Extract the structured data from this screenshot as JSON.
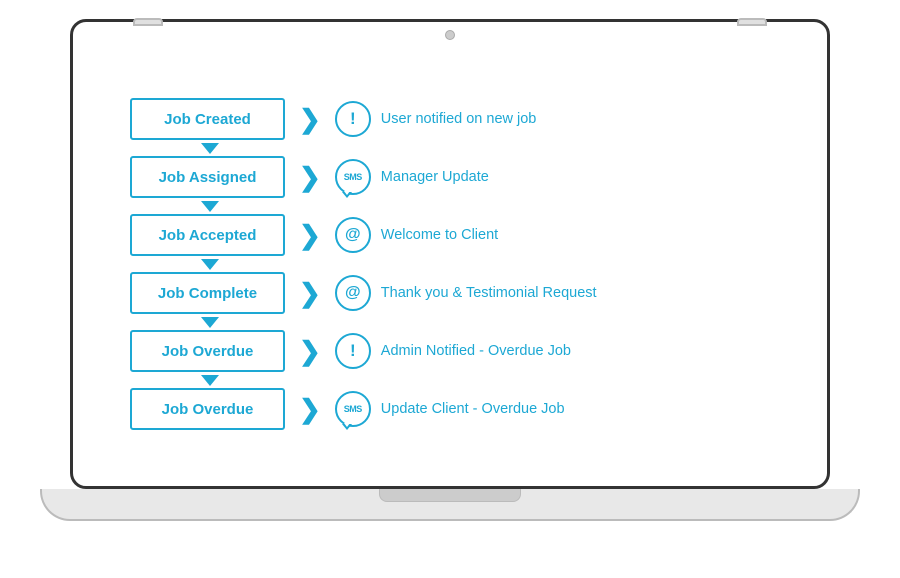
{
  "laptop": {
    "title": "Laptop mockup showing job automation flow"
  },
  "flow": {
    "rows": [
      {
        "jobLabel": "Job Created",
        "iconType": "exclamation",
        "iconLabel": "!",
        "actionText": "User notified on new job",
        "hasArrowAbove": false
      },
      {
        "jobLabel": "Job Assigned",
        "iconType": "sms",
        "iconLabel": "SMS",
        "actionText": "Manager Update",
        "hasArrowAbove": true
      },
      {
        "jobLabel": "Job Accepted",
        "iconType": "at",
        "iconLabel": "@",
        "actionText": "Welcome to Client",
        "hasArrowAbove": true
      },
      {
        "jobLabel": "Job Complete",
        "iconType": "at",
        "iconLabel": "@",
        "actionText": "Thank you & Testimonial Request",
        "hasArrowAbove": true
      },
      {
        "jobLabel": "Job Overdue",
        "iconType": "exclamation",
        "iconLabel": "!",
        "actionText": "Admin Notified - Overdue Job",
        "hasArrowAbove": true
      },
      {
        "jobLabel": "Job Overdue",
        "iconType": "sms",
        "iconLabel": "SMS",
        "actionText": "Update Client - Overdue Job",
        "hasArrowAbove": true
      }
    ]
  },
  "colors": {
    "brand": "#1da8d4",
    "border": "#333",
    "base": "#e8e8e8"
  }
}
